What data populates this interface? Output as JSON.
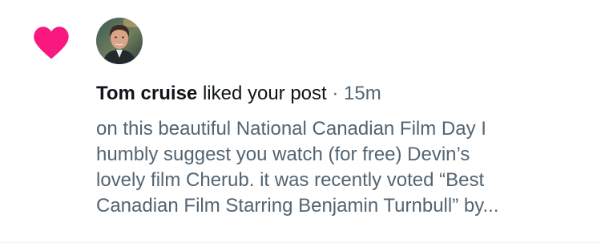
{
  "notification": {
    "type_icon": "heart-icon",
    "avatar_icon": "avatar",
    "actor_name": "Tom cruise",
    "action_text": "liked your post",
    "separator": "·",
    "timestamp": "15m",
    "post_preview_lines": [
      "on this beautiful National Canadian Film Day I",
      "humbly suggest you watch (for free) Devin’s",
      "lovely film Cherub. it was recently voted “Best",
      "Canadian Film Starring Benjamin Turnbull” by..."
    ]
  },
  "colors": {
    "heart": "#f91880",
    "primary_text": "#0f1419",
    "secondary_text": "#536471",
    "background": "#ffffff"
  }
}
